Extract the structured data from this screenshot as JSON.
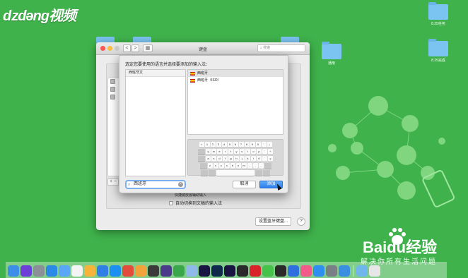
{
  "watermark": {
    "video_brand": "ǳdəng视频"
  },
  "baidu": {
    "logo_text": "Baidu经验",
    "slogan": "解决你所有生活问题"
  },
  "desktop": {
    "icons": [
      {
        "label": "8.25任务"
      },
      {
        "label": "8.25完成"
      },
      {
        "label": "通用"
      }
    ]
  },
  "prefs_window": {
    "title": "键盘",
    "search_placeholder": "搜索",
    "nav_back": "<",
    "nav_forward": ">",
    "grid_button": "▦",
    "add_remove": "+ −",
    "partial_label": "快捷键放置辅助输入",
    "auto_switch_label": "自动切换到文稿的输入法",
    "setup_button": "设置蓝牙键盘...",
    "help_button": "?"
  },
  "sheet": {
    "prompt": "选定您要使用的语言并选择要添加的输入法：",
    "languages": [
      "西班牙文"
    ],
    "sources": [
      {
        "label": "西班牙",
        "selected": true
      },
      {
        "label": "西班牙（ISO）",
        "selected": false
      }
    ],
    "keyboard_rows": [
      [
        "<",
        "1",
        "2",
        "3",
        "4",
        "5",
        "6",
        "7",
        "8",
        "9",
        "0",
        "'",
        "¡"
      ],
      [
        "q",
        "w",
        "e",
        "r",
        "t",
        "y",
        "u",
        "i",
        "o",
        "p",
        "`",
        "+"
      ],
      [
        "a",
        "s",
        "d",
        "f",
        "g",
        "h",
        "j",
        "k",
        "l",
        "ñ",
        "´",
        "ç"
      ],
      [
        "z",
        "x",
        "c",
        "v",
        "b",
        "n",
        "m",
        ",",
        ".",
        "-"
      ]
    ],
    "search_value": "西班牙",
    "cancel_button": "取消",
    "add_button": "添加"
  },
  "dock": {
    "apps": [
      {
        "name": "finder-icon",
        "color": "#3c8ee8"
      },
      {
        "name": "siri-icon",
        "color": "#6e3fd8"
      },
      {
        "name": "launchpad-icon",
        "color": "#8a8f98"
      },
      {
        "name": "safari-icon",
        "color": "#2b8ae6"
      },
      {
        "name": "mail-icon",
        "color": "#5aa7f5"
      },
      {
        "name": "calendar-icon",
        "color": "#f4f4f4"
      },
      {
        "name": "photos-icon",
        "color": "#f5b33a"
      },
      {
        "name": "baidu-netdisk-icon",
        "color": "#2f7fe6"
      },
      {
        "name": "app-store-icon",
        "color": "#1c8ff2"
      },
      {
        "name": "notes-app-icon",
        "color": "#e34b3b"
      },
      {
        "name": "butterfly-icon",
        "color": "#f2a23a"
      },
      {
        "name": "photo-booth-icon",
        "color": "#3a3a3a"
      },
      {
        "name": "video-player-icon",
        "color": "#4b3a8a"
      },
      {
        "name": "stocks-icon",
        "color": "#3aa84a"
      },
      {
        "name": "preview-icon",
        "color": "#8fb9e8"
      },
      {
        "name": "after-effects-icon",
        "color": "#1a1442"
      },
      {
        "name": "photoshop-icon",
        "color": "#0f2a4a"
      },
      {
        "name": "premiere-icon",
        "color": "#1a1442"
      },
      {
        "name": "final-cut-icon",
        "color": "#2a2a2a"
      },
      {
        "name": "netease-music-icon",
        "color": "#d8232a"
      },
      {
        "name": "wechat-icon",
        "color": "#46c24a"
      },
      {
        "name": "qq-icon",
        "color": "#2a2a2a"
      },
      {
        "name": "pencil-app-icon",
        "color": "#2f6fe0"
      },
      {
        "name": "itunes-icon",
        "color": "#f25a8a"
      },
      {
        "name": "app-store-2-icon",
        "color": "#2f8ff0"
      },
      {
        "name": "system-prefs-icon",
        "color": "#7a7f86"
      },
      {
        "name": "shield-app-icon",
        "color": "#3a8fe0"
      },
      {
        "name": "downloads-folder-icon",
        "color": "#6fb7ea"
      },
      {
        "name": "trash-icon",
        "color": "#e6e6e6"
      }
    ]
  }
}
